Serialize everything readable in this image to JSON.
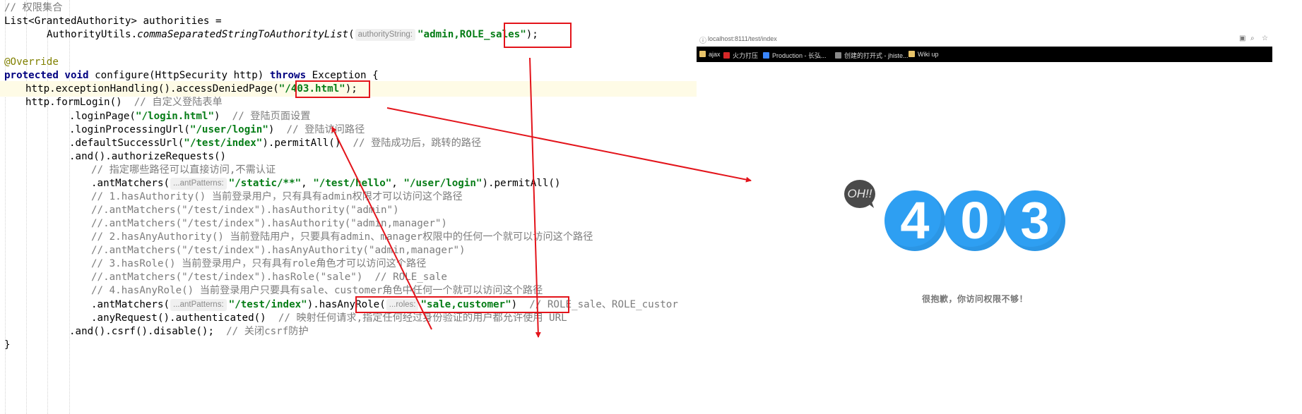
{
  "editor": {
    "lines": [
      [
        "// 权限集合"
      ],
      [
        "List<GrantedAuthority> authorities ="
      ],
      [
        "AuthorityUtils.",
        "commaSeparatedStringToAuthorityList",
        "(",
        "authorityString:",
        "\"admin,ROLE_sales\"",
        ");"
      ],
      [],
      [
        "@Override"
      ],
      [
        "protected",
        "void",
        "configure(HttpSecurity http)",
        "throws",
        "Exception {"
      ],
      [
        "http.exceptionHandling().accessDeniedPage(",
        "\"/403.html\"",
        ");"
      ],
      [
        "http.formLogin()",
        "// 自定义登陆表单"
      ],
      [
        ".loginPage(",
        "\"/login.html\"",
        ")",
        "// 登陆页面设置"
      ],
      [
        ".loginProcessingUrl(",
        "\"/user/login\"",
        ")",
        "// 登陆访问路径"
      ],
      [
        ".defaultSuccessUrl(",
        "\"/test/index\"",
        ").permitAll()",
        "// 登陆成功后，跳转的路径"
      ],
      [
        ".and().authorizeRequests()"
      ],
      [
        "// 指定哪些路径可以直接访问,不需认证"
      ],
      [
        ".antMatchers(",
        "...antPatterns:",
        "\"/static/**\"",
        ", ",
        "\"/test/hello\"",
        ", ",
        "\"/user/login\"",
        ").permitAll()"
      ],
      [
        "// 1.hasAuthority() 当前登录用户，只有具有admin权限才可以访问这个路径"
      ],
      [
        "//.antMatchers(\"/test/index\").hasAuthority(\"admin\")"
      ],
      [
        "//.antMatchers(\"/test/index\").hasAuthority(\"admin,manager\")"
      ],
      [
        "// 2.hasAnyAuthority() 当前登陆用户，只要具有admin、manager权限中的任何一个就可以访问这个路径"
      ],
      [
        "//.antMatchers(\"/test/index\").hasAnyAuthority(\"admin,manager\")"
      ],
      [
        "// 3.hasRole() 当前登录用户，只有具有role角色才可以访问这个路径"
      ],
      [
        "//.antMatchers(\"/test/index\").hasRole(\"sale\")",
        "// ROLE_sale"
      ],
      [
        "// 4.hasAnyRole() 当前登录用户只要具有sale、customer角色中任何一个就可以访问这个路径"
      ],
      [
        ".antMatchers(",
        "...antPatterns:",
        "\"/test/index\"",
        ").",
        "hasAnyRole(",
        "...roles:",
        "\"sale,customer\"",
        ")",
        "// ROLE_sale、ROLE_custor"
      ],
      [
        ".anyRequest().authenticated()",
        "// 映射任何请求,指定任何经过身份验证的用户都允许使用 URL"
      ],
      [
        ".and().csrf().disable();",
        "// 关闭csrf防护"
      ],
      [
        "}"
      ]
    ]
  },
  "browser": {
    "url": "localhost:8111/test/index",
    "bookmarks": [
      "ajax",
      "火力打压",
      "Production - 长弘...",
      "创建的打开式 - jhiste...",
      "Wiki up"
    ],
    "oh_text": "OH!!",
    "digits": [
      "4",
      "0",
      "3"
    ],
    "message": "很抱歉，你访问权限不够！"
  },
  "colors": {
    "annotation_red": "#e3141b",
    "digit_blue": "#2e9ff2",
    "keyword": "#000080",
    "string": "#067d17",
    "comment": "#7d7d7d"
  }
}
